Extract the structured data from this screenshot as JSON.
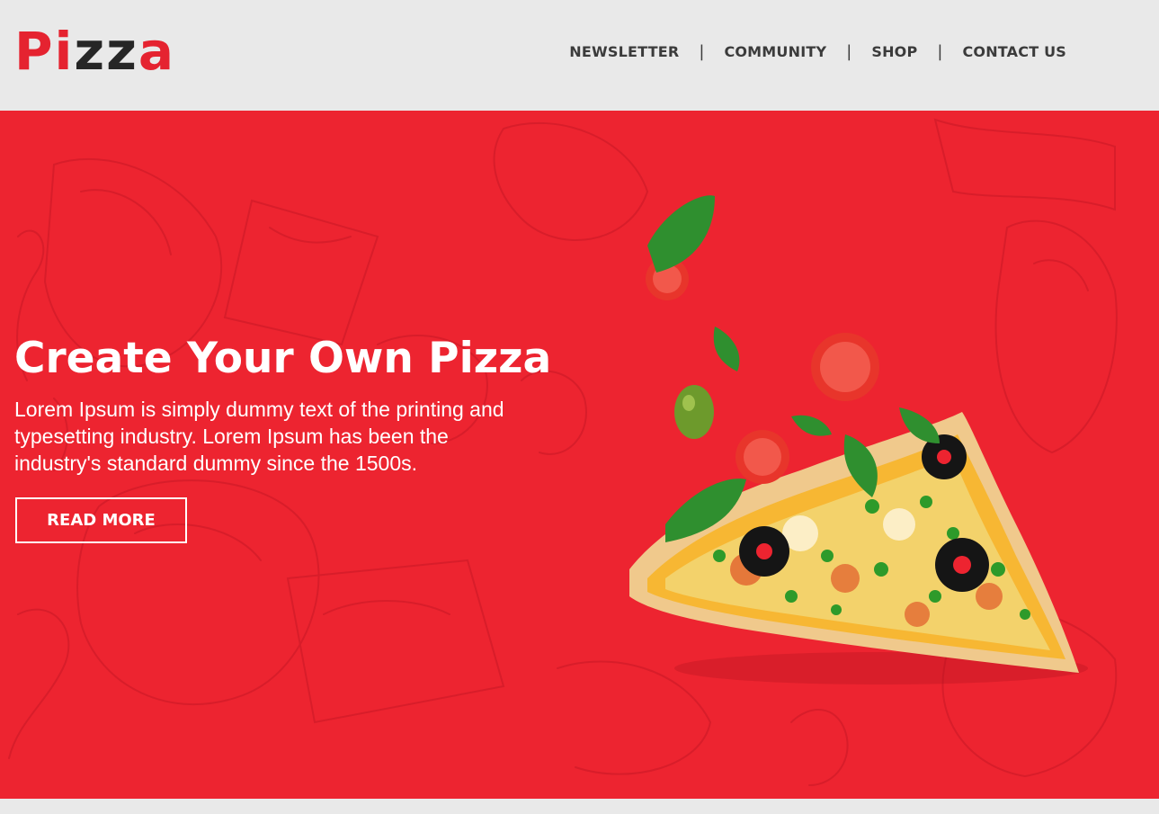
{
  "header": {
    "logo": {
      "part1": "Pi",
      "part2": "zz",
      "part3": "a"
    },
    "nav": [
      {
        "label": "NEWSLETTER"
      },
      {
        "label": "COMMUNITY"
      },
      {
        "label": "SHOP"
      },
      {
        "label": "CONTACT US"
      }
    ],
    "separator": "|"
  },
  "hero": {
    "title": "Create Your Own Pizza",
    "text": "Lorem Ipsum is simply dummy text of the printing and typesetting industry. Lorem Ipsum has been the industry's standard dummy since the 1500s.",
    "button_label": "READ MORE",
    "image_icon": "pizza-slice-icon"
  },
  "colors": {
    "brand_red": "#ed2430",
    "logo_dark": "#262626",
    "header_bg": "#e9e9e9",
    "nav_text": "#3b3b3b"
  }
}
